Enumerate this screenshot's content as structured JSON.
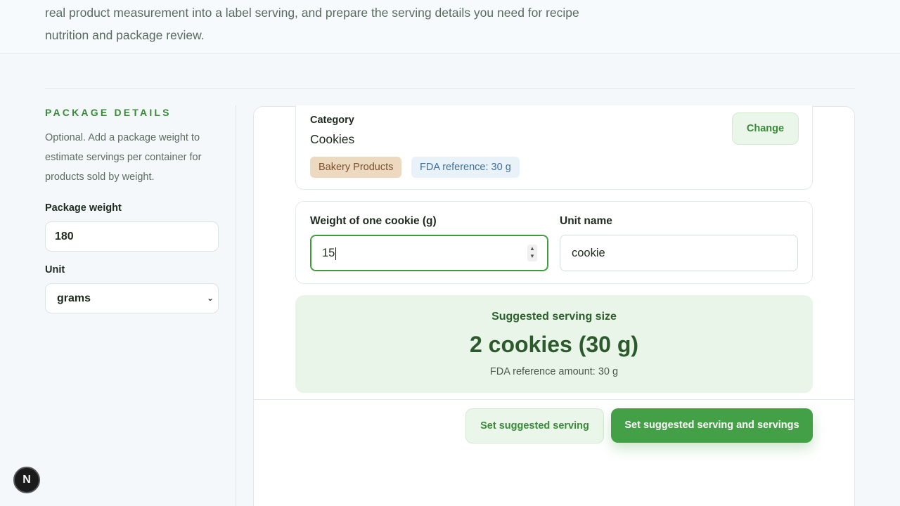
{
  "intro": {
    "text": "real product measurement into a label serving, and prepare the serving details you need for recipe nutrition and package review."
  },
  "package": {
    "eyebrow": "PACKAGE DETAILS",
    "help": "Optional. Add a package weight to estimate servings per container for products sold by weight.",
    "weight_label": "Package weight",
    "weight_value": "180",
    "unit_label": "Unit",
    "unit_value": "grams"
  },
  "category": {
    "label": "Category",
    "value": "Cookies",
    "badge_group": "Bakery Products",
    "badge_reference": "FDA reference: 30 g",
    "change_label": "Change"
  },
  "measure": {
    "weight_label": "Weight of one cookie (g)",
    "weight_value": "15",
    "unit_label": "Unit name",
    "unit_value": "cookie"
  },
  "suggestion": {
    "title": "Suggested serving size",
    "value": "2 cookies (30 g)",
    "reference": "FDA reference amount: 30 g"
  },
  "actions": {
    "set_serving": "Set suggested serving",
    "set_serving_and_servings": "Set suggested serving and servings"
  },
  "devtools": {
    "badge": "N"
  },
  "colors": {
    "accent": "#43a047",
    "accent_light": "#e8f5e8",
    "badge_bakery_bg": "#ecd9bf",
    "badge_fda_bg": "#eaf2f9"
  }
}
